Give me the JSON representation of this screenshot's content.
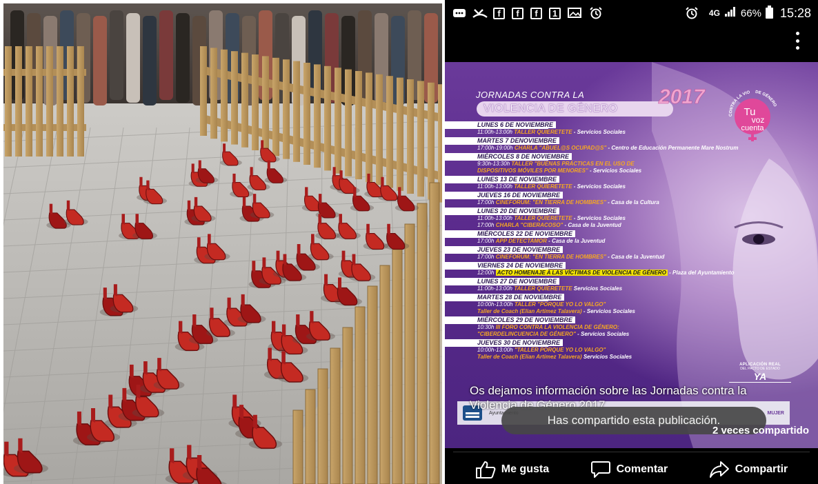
{
  "status_bar": {
    "battery_level": "66%",
    "clock": "15:28",
    "network": "4G",
    "notification_icons": [
      "chat-icon",
      "missed-call-icon",
      "facebook-icon",
      "facebook-icon",
      "facebook-icon",
      "sim-icon",
      "gallery-icon",
      "alarm-icon"
    ],
    "fb_letter": "f",
    "sim_label": "1"
  },
  "poster": {
    "title_line1": "JORNADAS CONTRA LA",
    "title_line2": "VIOLENCIA DE GÉNERO",
    "year": "2017",
    "logo": {
      "arc_text": "CONTRA LA VIOLENCIA",
      "arc_text_right": "DE GÉNERO",
      "line1": "Tu",
      "line2": "voz",
      "line3": "cuenta"
    },
    "events": [
      {
        "date": "LUNES 6 DE NOVIEMBRE",
        "lines": [
          {
            "time": "11:00h-13:00h",
            "name": "TALLER QUIERETETE",
            "place": "- Servicios Sociales"
          }
        ]
      },
      {
        "date": "MARTES 7 DENOVIEMBRE",
        "lines": [
          {
            "time": "17:00h-19:00h",
            "name": "CHARLA \"ABUEL@S OCUPAD@S\"",
            "place": "- Centro de Educación Permanente Mare Nostrum"
          }
        ]
      },
      {
        "date": "MIÉRCOLES 8 DE NOVIEMBRE",
        "lines": [
          {
            "time": "9:30h-13:30h",
            "name": "TALLER \"BUENAS PRÁCTICAS EN EL USO DE",
            "place": ""
          },
          {
            "time": "",
            "name": "DISPOSITIVOS MÓVILES POR MENORES\"",
            "place": "- Servicios Sociales"
          }
        ]
      },
      {
        "date": "LUNES 13 DE NOVIEMBRE",
        "lines": [
          {
            "time": "11:00h-13:00h",
            "name": "TALLER QUIERETETE",
            "place": "- Servicios Sociales"
          }
        ]
      },
      {
        "date": "JUEVES 16 DE NOVIEMBRE",
        "lines": [
          {
            "time": "17:00h",
            "name": "CINEFORUM: \"EN TIERRA DE HOMBRES\"",
            "place": "- Casa de la Cultura"
          }
        ]
      },
      {
        "date": "LUNES 20 DE NOVIEMBRE",
        "lines": [
          {
            "time": "11:00h-13:00h",
            "name": "TALLER QUIERETETE",
            "place": "- Servicios Sociales"
          },
          {
            "time": "17:00h",
            "name": "CHARLA \"CIBERACOSO\"",
            "place": "- Casa de la Juventud"
          }
        ]
      },
      {
        "date": "MIÉRCOLES 22 DE NOVIEMBRE",
        "lines": [
          {
            "time": "17:00h",
            "name": "APP DETECTAMOR",
            "place": "- Casa de la Juventud"
          }
        ]
      },
      {
        "date": "JUEVES 23 DE NOVIEMBRE",
        "lines": [
          {
            "time": "17:00h",
            "name": "CINEFORUM: \"EN TIERRA DE HOMBRES\"",
            "place": "- Casa de la Juventud"
          }
        ]
      },
      {
        "date": "VIERNES 24 DE NOVIEMBRE",
        "lines": [
          {
            "time": "12:00h",
            "name": "ACTO HOMENAJE A LAS VÍCTIMAS DE VIOLENCIA DE GÉNERO",
            "place": "- Plaza del Ayuntamiento",
            "highlight": true
          }
        ]
      },
      {
        "date": "LUNES 27 DE NOVIEMBRE",
        "lines": [
          {
            "time": "11:00h-13:00h",
            "name": "TALLER QUIERETETE",
            "place": "Servicios Sociales"
          }
        ]
      },
      {
        "date": "MARTES 28 DE NOVIEMBRE",
        "lines": [
          {
            "time": "10:00h-13:00h",
            "name": "TALLER \"PORQUE YO LO VALGO\"",
            "place": ""
          },
          {
            "time": "",
            "name": "Taller de Coach (Elian Artímez Talavera)",
            "place": "- Servicios Sociales"
          }
        ]
      },
      {
        "date": "MIÉRCOLES 29 DE NOVIEMBRE",
        "lines": [
          {
            "time": "10:30h",
            "name": "III FORO CONTRA LA VIOLENCIA DE GÉNERO:",
            "place": ""
          },
          {
            "time": "",
            "name": "\"CIBERDELINCUENCIA DE GÉNERO\"",
            "place": "- Servicios Sociales"
          }
        ]
      },
      {
        "date": "JUEVES 30 DE NOVIEMBRE",
        "lines": [
          {
            "time": "10:00h-13:00h",
            "name": "\"TALLER PORQUE YO LO VALGO\"",
            "place": ""
          },
          {
            "time": "",
            "name": "Taller de Coach (Elian Artímez Talavera)",
            "place": "Servicios Sociales"
          }
        ]
      }
    ],
    "ya": {
      "caption": "APLICACIÓN REAL",
      "sub": "DEL PACTO DE ESTADO",
      "text": "YA"
    },
    "footer": {
      "ayuntamiento": "Ayuntamiento",
      "mujer": "MUJER"
    }
  },
  "post": {
    "caption": "Os dejamos información sobre las Jornadas contra la Violencia de Género 2017",
    "toast": "Has compartido esta publicación.",
    "share_count": "2 veces compartido"
  },
  "actions": {
    "like": "Me gusta",
    "comment": "Comentar",
    "share": "Compartir"
  },
  "colors": {
    "poster_purple": "#5a2a8c",
    "event_name_orange": "#f5a623",
    "highlight_yellow": "#f4e400",
    "logo_pink": "#e0489a",
    "shoe_red": "#b51d1d"
  }
}
